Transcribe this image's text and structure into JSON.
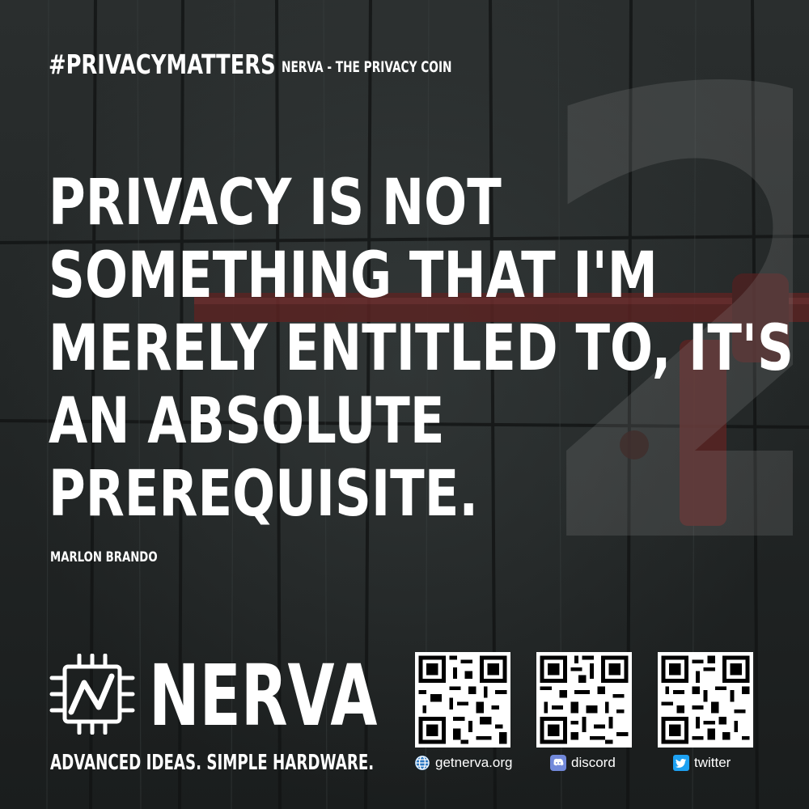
{
  "header": {
    "hashtag": "#PRIVACYMATTERS",
    "subtitle": "NERVA - THE PRIVACY COIN"
  },
  "background": {
    "big_number": "2"
  },
  "quote": {
    "lines": [
      "PRIVACY IS NOT",
      "SOMETHING THAT I'M",
      "MERELY ENTITLED TO, IT'S",
      "AN ABSOLUTE",
      "PREREQUISITE."
    ],
    "author": "MARLON BRANDO"
  },
  "brand": {
    "name": "NERVA",
    "tagline": "ADVANCED IDEAS. SIMPLE HARDWARE.",
    "logo_icon": "cpu-chip-icon"
  },
  "links": [
    {
      "label": "getnerva.org",
      "icon": "globe-icon"
    },
    {
      "label": "discord",
      "icon": "discord-icon"
    },
    {
      "label": "twitter",
      "icon": "twitter-icon"
    }
  ],
  "colors": {
    "text": "#ffffff",
    "background": "#232727",
    "globe": "#2b78c2",
    "discord": "#7289da",
    "twitter": "#1da1f2"
  }
}
